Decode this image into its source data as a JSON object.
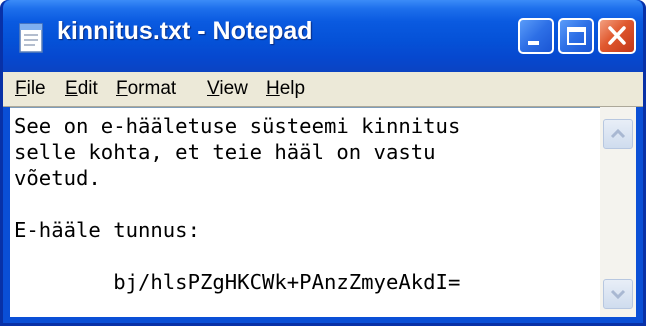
{
  "window": {
    "title": "kinnitus.txt - Notepad"
  },
  "menu": [
    {
      "label": "File"
    },
    {
      "label": "Edit"
    },
    {
      "label": "Format"
    },
    {
      "label": "View"
    },
    {
      "label": "Help"
    }
  ],
  "document": {
    "lines": [
      "See on e-hääletuse süsteemi kinnitus",
      "selle kohta, et teie hääl on vastu",
      "võetud.",
      "",
      "E-hääle tunnus:",
      "",
      "        bj/hlsPZgHKCWk+PAnzZmyeAkdI="
    ]
  },
  "icons": {
    "app": "notepad-icon",
    "minimize": "minimize-icon",
    "maximize": "maximize-icon",
    "close": "close-icon",
    "scroll_up": "scroll-up-arrow-icon",
    "scroll_down": "scroll-down-arrow-icon"
  },
  "colors": {
    "titlebar": "#0552d8",
    "close_button": "#e0582e",
    "menubar": "#ece9d8",
    "editor_background": "#ffffff"
  }
}
